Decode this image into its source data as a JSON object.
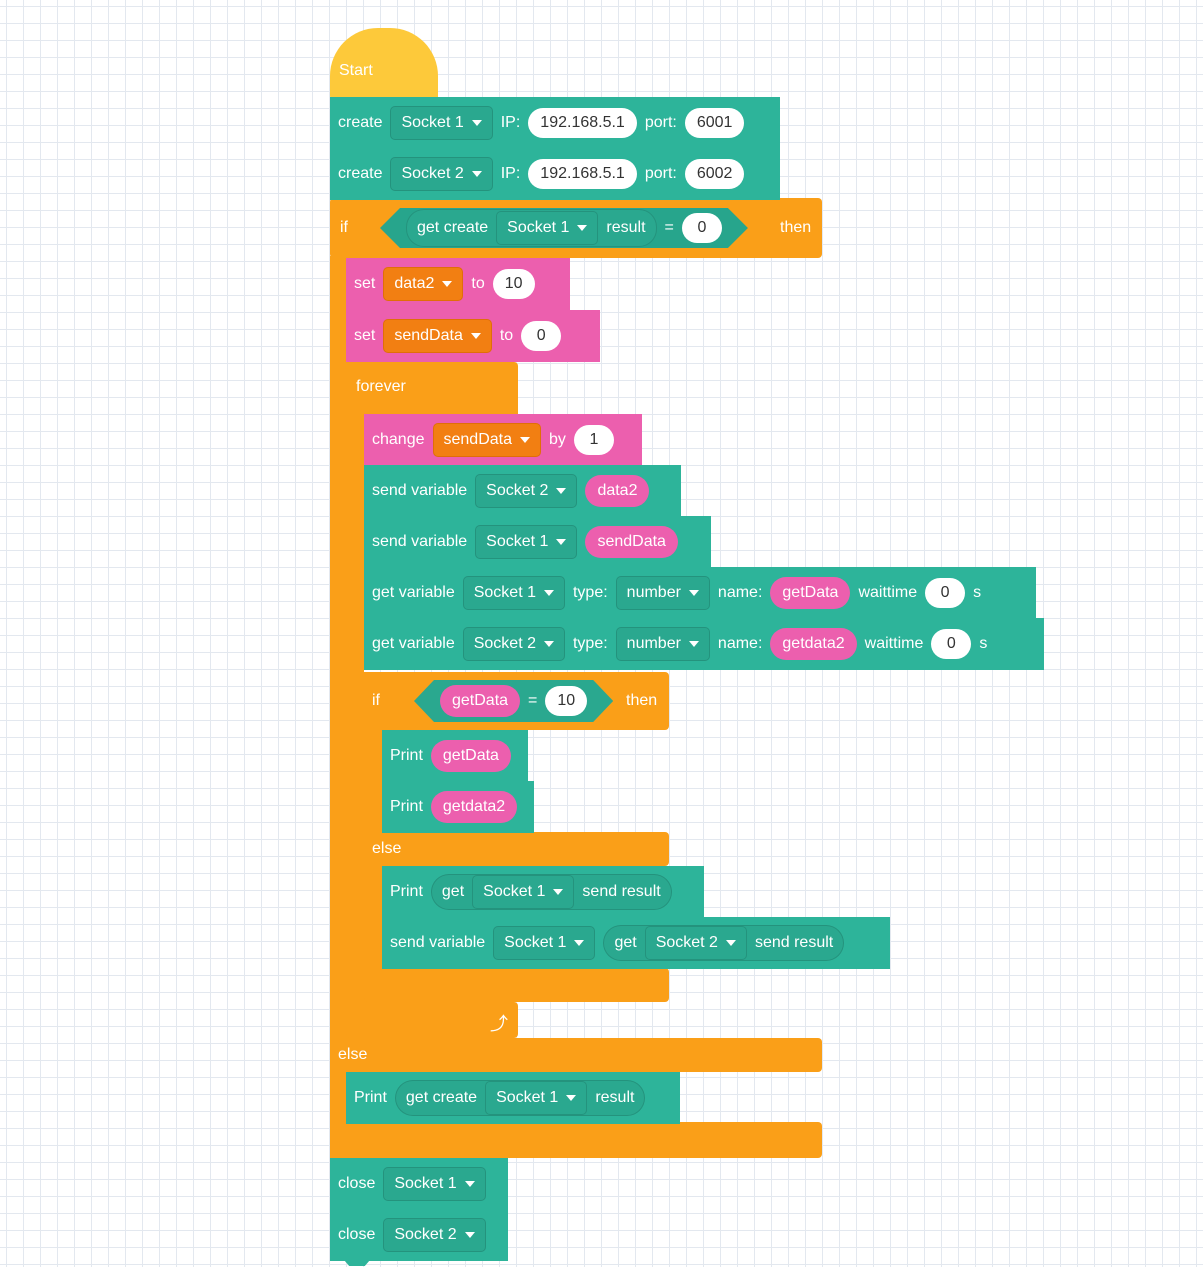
{
  "hat": {
    "label": "Start"
  },
  "create1": {
    "label": "create",
    "socket": "Socket 1",
    "ip_label": "IP:",
    "ip": "192.168.5.1",
    "port_label": "port:",
    "port": "6001"
  },
  "create2": {
    "label": "create",
    "socket": "Socket 2",
    "ip_label": "IP:",
    "ip": "192.168.5.1",
    "port_label": "port:",
    "port": "6002"
  },
  "if1": {
    "if": "if",
    "get_create": "get create",
    "socket": "Socket 1",
    "result": "result",
    "op": "=",
    "value": "0",
    "then": "then"
  },
  "set1": {
    "label": "set",
    "var": "data2",
    "to": "to",
    "value": "10"
  },
  "set2": {
    "label": "set",
    "var": "sendData",
    "to": "to",
    "value": "0"
  },
  "forever": {
    "label": "forever"
  },
  "change": {
    "label": "change",
    "var": "sendData",
    "by": "by",
    "value": "1"
  },
  "send1": {
    "label": "send variable",
    "socket": "Socket 2",
    "var": "data2"
  },
  "send2": {
    "label": "send variable",
    "socket": "Socket 1",
    "var": "sendData"
  },
  "get1": {
    "label": "get variable",
    "socket": "Socket 1",
    "type_label": "type:",
    "type": "number",
    "name_label": "name:",
    "name": "getData",
    "wait_label": "waittime",
    "wait": "0",
    "unit": "s"
  },
  "get2": {
    "label": "get variable",
    "socket": "Socket 2",
    "type_label": "type:",
    "type": "number",
    "name_label": "name:",
    "name": "getdata2",
    "wait_label": "waittime",
    "wait": "0",
    "unit": "s"
  },
  "if2": {
    "if": "if",
    "var": "getData",
    "op": "=",
    "value": "10",
    "then": "then"
  },
  "print1": {
    "label": "Print",
    "var": "getData"
  },
  "print2": {
    "label": "Print",
    "var": "getdata2"
  },
  "else2": {
    "label": "else"
  },
  "print3": {
    "label": "Print",
    "get": "get",
    "socket": "Socket 1",
    "suffix": "send result"
  },
  "send3": {
    "label": "send variable",
    "socket": "Socket 1",
    "get": "get",
    "socket2": "Socket 2",
    "suffix": "send result"
  },
  "loop_icon": {
    "glyph": "⤴"
  },
  "else1": {
    "label": "else"
  },
  "print4": {
    "label": "Print",
    "get_create": "get create",
    "socket": "Socket 1",
    "result": "result"
  },
  "close1": {
    "label": "close",
    "socket": "Socket 1"
  },
  "close2": {
    "label": "close",
    "socket": "Socket 2"
  },
  "colors": {
    "socket_block": "#2db49a",
    "control": "#fa9f18",
    "variable": "#ec5fae",
    "event": "#fdc93a"
  }
}
